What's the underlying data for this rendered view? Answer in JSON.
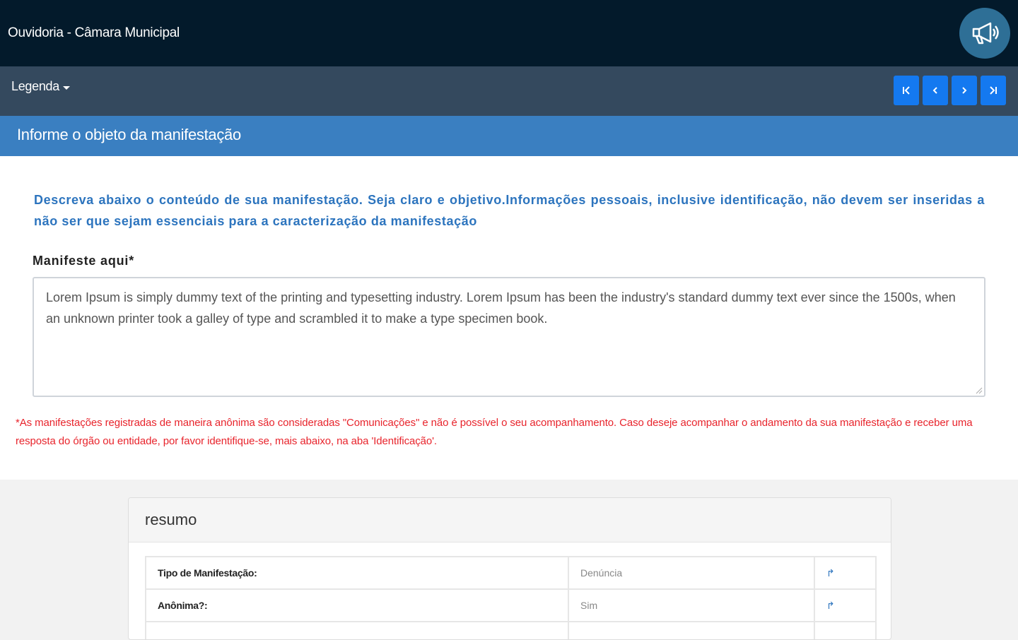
{
  "header": {
    "title": "Ouvidoria - Câmara Municipal",
    "megaphone_icon": "megaphone-icon"
  },
  "navbar": {
    "legend_label": "Legenda",
    "pager": [
      {
        "name": "first-page",
        "icon": "first-page-icon"
      },
      {
        "name": "previous-page",
        "icon": "previous-page-icon"
      },
      {
        "name": "next-page",
        "icon": "next-page-icon"
      },
      {
        "name": "last-page",
        "icon": "last-page-icon"
      }
    ]
  },
  "section": {
    "title": "Informe o objeto da manifestação"
  },
  "form": {
    "instructions": "Descreva abaixo o conteúdo de sua manifestação. Seja claro e objetivo.Informações pessoais, inclusive identificação, não devem ser inseridas a não ser que sejam essenciais para a caracterização da manifestação",
    "label": "Manifeste aqui*",
    "text": "Lorem Ipsum is simply dummy text of the printing and typesetting industry. Lorem Ipsum has been the industry's standard dummy text ever since the 1500s, when an unknown printer took a galley of type and scrambled it to make a type specimen book.",
    "warning": "*As manifestações registradas de maneira anônima são consideradas \"Comunicações\" e não é possível o seu acompanhamento. Caso deseje acompanhar o andamento da sua manifestação e receber uma resposta do órgão ou entidade, por favor identifique-se, mais abaixo, na aba 'Identificação'."
  },
  "summary": {
    "title": "resumo",
    "rows": [
      {
        "label": "Tipo de Manifestação:",
        "value": "Denúncia",
        "action": "↱"
      },
      {
        "label": "Anônima?:",
        "value": "Sim",
        "action": "↱"
      },
      {
        "label": "",
        "value": "",
        "action": ""
      }
    ]
  },
  "colors": {
    "topbar": "#031a2b",
    "navbar": "#34495e",
    "section_header": "#3a7fc1",
    "pager_button": "#1479f0",
    "instruction_text": "#2c74be",
    "warning_text": "#e8242c"
  }
}
